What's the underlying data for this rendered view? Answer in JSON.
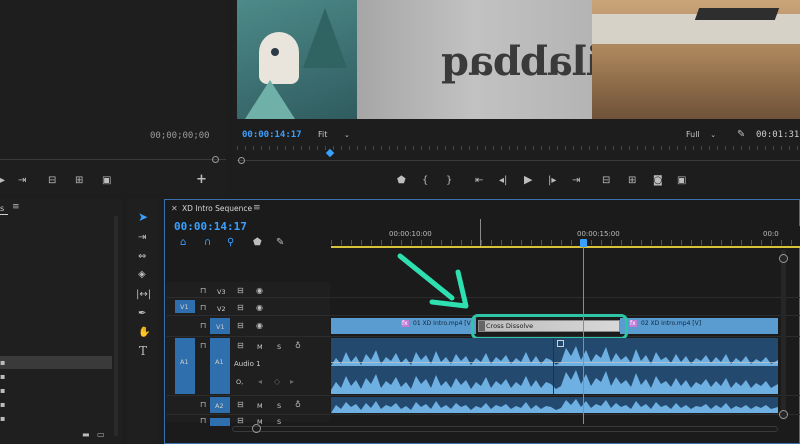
{
  "source_monitor": {
    "timecode": "00;00;00;00"
  },
  "program_monitor": {
    "timecode_left": "00:00:14:17",
    "fit_label": "Fit",
    "full_label": "Full",
    "timecode_right": "00:01:31:",
    "video_text": "ilabbaq"
  },
  "timeline": {
    "tab_title": "XD Intro Sequence",
    "timecode": "00:00:14:17",
    "ruler": [
      "00:00:10:00",
      "00:00:15:00",
      "00:0"
    ],
    "tracks": {
      "v3": "V3",
      "v2": "V2",
      "v1": "V1",
      "a1": "A1",
      "a2": "A2",
      "src_v1": "V1",
      "src_a1": "A1",
      "audio_name": "Audio 1",
      "m": "M",
      "s": "S",
      "o": "O,"
    },
    "clips": {
      "clip1": "01 XD Intro.mp4 [V]",
      "clip2": "02 XD Intro.mp4 [V]",
      "transition": "Cross Dissolve",
      "fx": "fx"
    }
  },
  "colors": {
    "timecode": "#3aa0ff",
    "clip": "#5a9ccf",
    "audio": "#4a8fc8",
    "highlight": "#2ec4a6",
    "arrow": "#2edfb0",
    "work_bar": "#d9c338"
  }
}
